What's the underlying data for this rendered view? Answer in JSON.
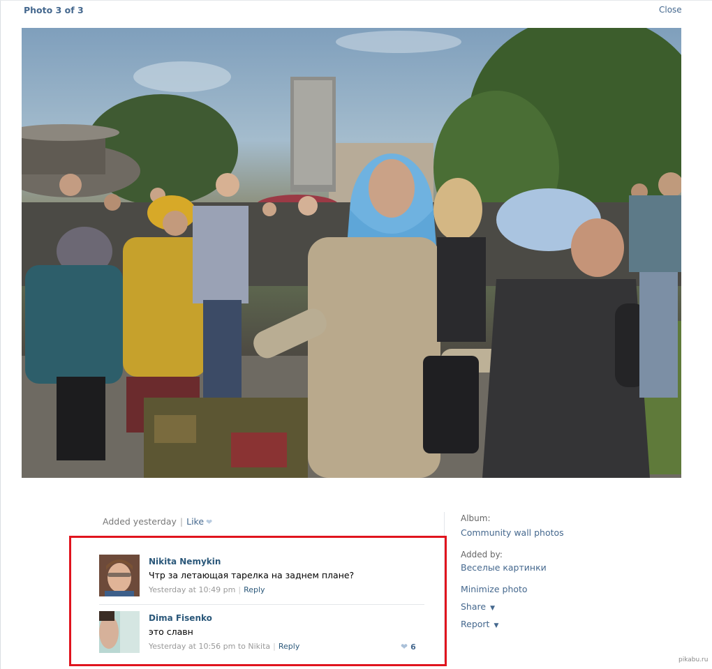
{
  "header": {
    "photo_counter": "Photo 3 of 3",
    "close_label": "Close"
  },
  "meta": {
    "added": "Added yesterday",
    "separator": "|",
    "like_label": "Like"
  },
  "comments": [
    {
      "author": "Nikita Nemykin",
      "text": "Чтр за летающая тарелка на заднем плане?",
      "time": "Yesterday at 10:49 pm",
      "reply_label": "Reply"
    },
    {
      "author": "Dima Fisenko",
      "text": "это славн",
      "time": "Yesterday at 10:56 pm",
      "reply_to": "to Nikita",
      "reply_label": "Reply",
      "likes": "6"
    }
  ],
  "sidebar": {
    "album_label": "Album:",
    "album_name": "Community wall photos",
    "added_by_label": "Added by:",
    "added_by_name": "Веселые картинки",
    "minimize": "Minimize photo",
    "share": "Share",
    "report": "Report"
  },
  "watermark": "pikabu.ru",
  "colors": {
    "link": "#45688e",
    "author": "#2b587a",
    "highlight_border": "#e0141e"
  },
  "icons": [
    "heart-icon",
    "caret-down-icon"
  ]
}
